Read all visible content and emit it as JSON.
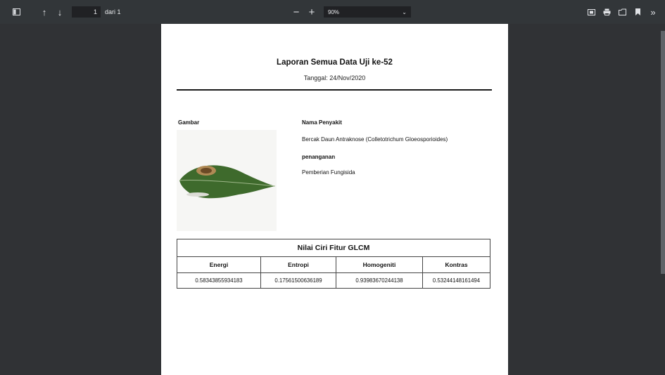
{
  "toolbar": {
    "page_current": "1",
    "page_total": "dari 1",
    "zoom_value": "90%"
  },
  "report": {
    "title": "Laporan Semua Data Uji ke-52",
    "date": "Tanggal: 24/Nov/2020",
    "image_label": "Gambar",
    "disease_label": "Nama Penyakit",
    "disease_value": "Bercak Daun Antraknose (Colletotrichum Gloeosporioides)",
    "handling_label": "penanganan",
    "handling_value": "Pemberian Fungisida"
  },
  "glcm": {
    "caption": "Nilai Ciri Fitur GLCM",
    "headers": [
      "Energi",
      "Entropi",
      "Homogeniti",
      "Kontras"
    ],
    "values": [
      "0.58343855934183",
      "0.17561500636189",
      "0.93983670244138",
      "0.53244148161494"
    ]
  }
}
